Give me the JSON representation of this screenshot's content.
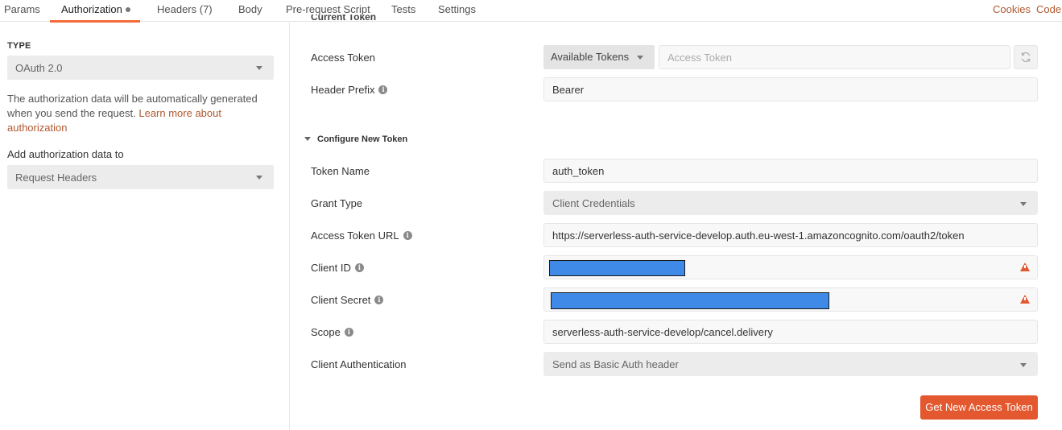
{
  "tabs": [
    {
      "label": "Params"
    },
    {
      "label": "Authorization"
    },
    {
      "label": "Headers (7)"
    },
    {
      "label": "Body"
    },
    {
      "label": "Pre-request Script"
    },
    {
      "label": "Tests"
    },
    {
      "label": "Settings"
    }
  ],
  "top_links": {
    "cookies": "Cookies",
    "code": "Code"
  },
  "left": {
    "type_label": "TYPE",
    "type_value": "OAuth 2.0",
    "description": "The authorization data will be automatically generated when you send the request.",
    "learn_more": "Learn more about authorization",
    "add_label": "Add authorization data to",
    "add_value": "Request Headers"
  },
  "current_token": {
    "title": "Current Token",
    "access_token_label": "Access Token",
    "available_tokens": "Available Tokens",
    "access_token_placeholder": "Access Token",
    "header_prefix_label": "Header Prefix",
    "header_prefix_value": "Bearer"
  },
  "new_token": {
    "title": "Configure New Token",
    "token_name_label": "Token Name",
    "token_name_value": "auth_token",
    "grant_type_label": "Grant Type",
    "grant_type_value": "Client Credentials",
    "access_token_url_label": "Access Token URL",
    "access_token_url_value": "https://serverless-auth-service-develop.auth.eu-west-1.amazoncognito.com/oauth2/token",
    "client_id_label": "Client ID",
    "client_secret_label": "Client Secret",
    "scope_label": "Scope",
    "scope_value": "serverless-auth-service-develop/cancel.delivery",
    "client_auth_label": "Client Authentication",
    "client_auth_value": "Send as Basic Auth header",
    "get_token_button": "Get New Access Token"
  },
  "colors": {
    "accent": "#e3582f",
    "link": "#b0582f",
    "redaction": "#3e8ae6"
  }
}
